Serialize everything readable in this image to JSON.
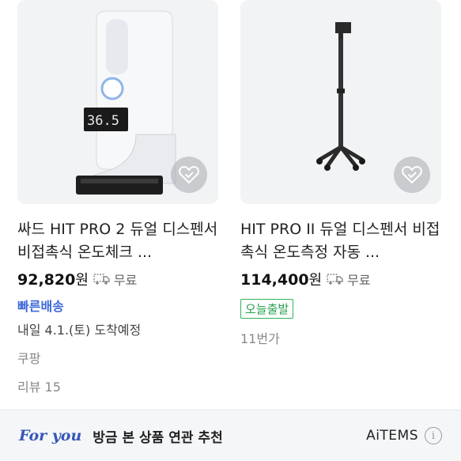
{
  "products": [
    {
      "title": "싸드 HIT PRO 2 듀얼 디스펜서 비접촉식 온도체크 ...",
      "price": "92,820",
      "currency": "원",
      "shipping": "무료",
      "fast_badge": "빠른배송",
      "arrival": "내일 4.1.(토) 도착예정",
      "seller": "쿠팡",
      "review": "리뷰 15",
      "display_temp": "36.5"
    },
    {
      "title": "HIT PRO II 듀얼 디스펜서 비접촉식 온도측정 자동 ...",
      "price": "114,400",
      "currency": "원",
      "shipping": "무료",
      "today_badge": "오늘출발",
      "price_count": "11번가"
    }
  ],
  "foryou": {
    "brand": "For you",
    "text": "방금 본 상품 연관 추천",
    "aitems": "AiTEMS",
    "info_glyph": "i"
  },
  "icons": {
    "wishlist": "heart-check-icon",
    "shipping": "truck-icon",
    "info": "info-icon"
  },
  "colors": {
    "fast_badge": "#3c68d8",
    "today_badge": "#2a9f4f",
    "brand": "#3557b8"
  }
}
